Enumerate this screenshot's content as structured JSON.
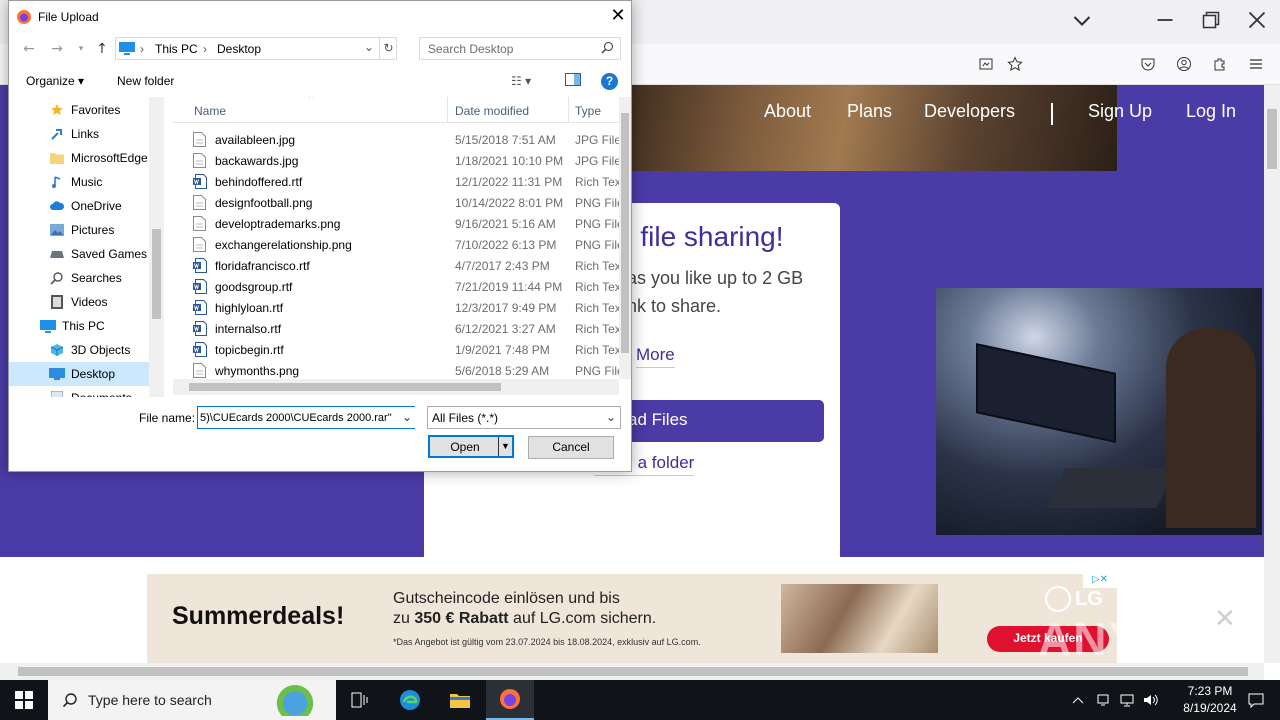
{
  "browser": {
    "nav": [
      "About",
      "Plans",
      "Developers",
      "Sign Up",
      "Log In"
    ]
  },
  "page": {
    "card_title": "e file sharing!",
    "card_line1": "as you like up to 2 GB",
    "card_line2": "nk to share.",
    "more_link": "More",
    "upload_files": "ad Files",
    "upload_folder": "ad a folder"
  },
  "ad": {
    "title": "Summerdeals!",
    "line1": "Gutscheincode einlösen und bis",
    "line2_pre": "zu ",
    "line2_bold": "350 € Rabatt",
    "line2_post": " auf LG.com sichern.",
    "fine": "*Das Angebot ist gültig vom 23.07.2024 bis 18.08.2024, exklusiv auf LG.com.",
    "brand": "LG",
    "cta": "Jetzt kaufen"
  },
  "watermark": "ANY RUN",
  "taskbar": {
    "search_placeholder": "Type here to search",
    "time": "7:23 PM",
    "date": "8/19/2024"
  },
  "dialog": {
    "title": "File Upload",
    "address": [
      "This PC",
      "Desktop"
    ],
    "search_placeholder": "Search Desktop",
    "organize": "Organize",
    "new_folder": "New folder",
    "columns": [
      "Name",
      "Date modified",
      "Type"
    ],
    "tree": [
      {
        "label": "Favorites",
        "icon": "star-icon"
      },
      {
        "label": "Links",
        "icon": "links-icon"
      },
      {
        "label": "MicrosoftEdge",
        "icon": "folder-icon"
      },
      {
        "label": "Music",
        "icon": "music-icon"
      },
      {
        "label": "OneDrive",
        "icon": "cloud-icon"
      },
      {
        "label": "Pictures",
        "icon": "pictures-icon"
      },
      {
        "label": "Saved Games",
        "icon": "games-icon"
      },
      {
        "label": "Searches",
        "icon": "search-icon"
      },
      {
        "label": "Videos",
        "icon": "videos-icon"
      },
      {
        "label": "This PC",
        "icon": "computer-icon"
      },
      {
        "label": "3D Objects",
        "icon": "cube-icon"
      },
      {
        "label": "Desktop",
        "icon": "desktop-icon",
        "selected": true
      },
      {
        "label": "Documents",
        "icon": "documents-icon"
      }
    ],
    "files": [
      {
        "name": "availableen.jpg",
        "date": "5/15/2018 7:51 AM",
        "type": "JPG File",
        "kind": "img"
      },
      {
        "name": "backawards.jpg",
        "date": "1/18/2021 10:10 PM",
        "type": "JPG File",
        "kind": "img"
      },
      {
        "name": "behindoffered.rtf",
        "date": "12/1/2022 11:31 PM",
        "type": "Rich Text",
        "kind": "rtf"
      },
      {
        "name": "designfootball.png",
        "date": "10/14/2022 8:01 PM",
        "type": "PNG File",
        "kind": "img"
      },
      {
        "name": "developtrademarks.png",
        "date": "9/16/2021 5:16 AM",
        "type": "PNG File",
        "kind": "img"
      },
      {
        "name": "exchangerelationship.png",
        "date": "7/10/2022 6:13 PM",
        "type": "PNG File",
        "kind": "img"
      },
      {
        "name": "floridafrancisco.rtf",
        "date": "4/7/2017 2:43 PM",
        "type": "Rich Text",
        "kind": "rtf"
      },
      {
        "name": "goodsgroup.rtf",
        "date": "7/21/2019 11:44 PM",
        "type": "Rich Text",
        "kind": "rtf"
      },
      {
        "name": "highlyloan.rtf",
        "date": "12/3/2017 9:49 PM",
        "type": "Rich Text",
        "kind": "rtf"
      },
      {
        "name": "internalso.rtf",
        "date": "6/12/2021 3:27 AM",
        "type": "Rich Text",
        "kind": "rtf"
      },
      {
        "name": "topicbegin.rtf",
        "date": "1/9/2021 7:48 PM",
        "type": "Rich Text",
        "kind": "rtf"
      },
      {
        "name": "whymonths.png",
        "date": "5/6/2018 5:29 AM",
        "type": "PNG File",
        "kind": "img"
      }
    ],
    "file_name_label": "File name:",
    "file_name_value": "5)\\CUEcards 2000\\CUEcards 2000.rar\"",
    "file_type": "All Files (*.*)",
    "open": "Open",
    "cancel": "Cancel"
  },
  "colors": {
    "brand_purple": "#4b3ba6",
    "accent_blue": "#0078d7",
    "selection": "#cce8ff"
  }
}
